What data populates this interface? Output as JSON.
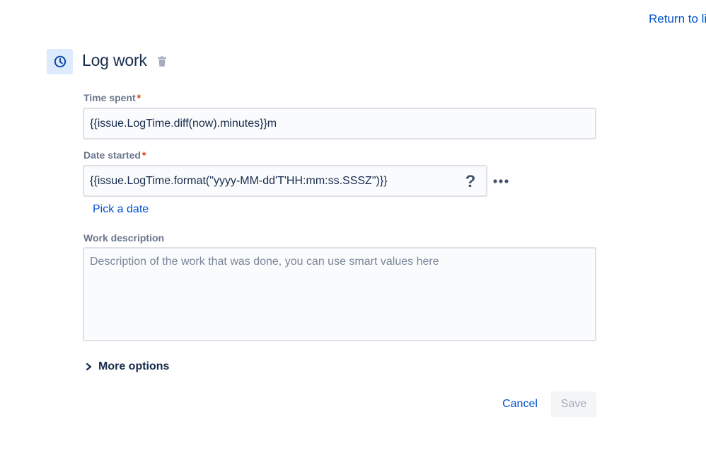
{
  "header": {
    "return_link": "Return to li",
    "title": "Log work",
    "icon": "clock-icon",
    "delete_icon": "trash-icon"
  },
  "form": {
    "time_spent": {
      "label": "Time spent",
      "required_marker": "*",
      "value": "{{issue.LogTime.diff(now).minutes}}m"
    },
    "date_started": {
      "label": "Date started",
      "required_marker": "*",
      "value": "{{issue.LogTime.format(\"yyyy-MM-dd'T'HH:mm:ss.SSSZ\")}}",
      "help_glyph": "?",
      "more_icon": "more-horizontal-icon",
      "pick_date_link": "Pick a date"
    },
    "work_description": {
      "label": "Work description",
      "placeholder": "Description of the work that was done, you can use smart values here",
      "value": ""
    },
    "more_options": {
      "label": "More options",
      "icon": "chevron-right-icon"
    }
  },
  "actions": {
    "cancel_label": "Cancel",
    "save_label": "Save"
  },
  "colors": {
    "link": "#0052cc",
    "text": "#172b4d",
    "label": "#6b778c",
    "required": "#de350b",
    "icon_bg": "#deebff",
    "input_bg": "#fafbfc",
    "input_border": "#dfe1e6",
    "disabled_bg": "#f4f5f7",
    "disabled_text": "#a5adba"
  }
}
